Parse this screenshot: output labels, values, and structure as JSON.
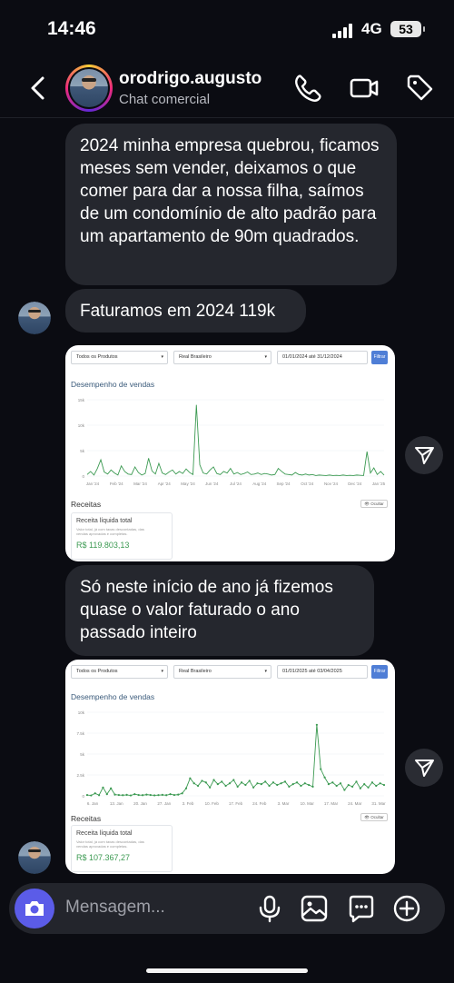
{
  "status_bar": {
    "time": "14:46",
    "network": "4G",
    "battery": "53"
  },
  "header": {
    "name": "orodrigo.augusto",
    "subtitle": "Chat comercial",
    "icons": [
      "back-icon",
      "phone-icon",
      "video-icon",
      "tag-icon"
    ]
  },
  "messages": [
    {
      "text": "2024 minha empresa quebrou, ficamos meses sem vender, deixamos o que comer para dar a nossa filha, saímos de um condomínio de alto padrão para um apartamento de 90m quadrados."
    },
    {
      "text": "Faturamos em 2024 119k"
    },
    {
      "text": "Só neste início de ano já fizemos quase o valor faturado o ano passado inteiro"
    }
  ],
  "screenshot_1": {
    "filter_products": "Todos os Produtos",
    "filter_currency": "Real Brasileiro",
    "filter_dates": "01/01/2024 até 31/12/2024",
    "filter_button": "Filtrar",
    "section_title": "Desempenho de vendas",
    "revenue_title": "Receitas",
    "hide_button": "Ocultar",
    "revenue_card_title": "Receita líquida total",
    "revenue_card_desc": "Valor total, já com taxas descontadas, das vendas aprovadas e completas.",
    "revenue_value": "R$ 119.803,13",
    "chart_data": {
      "type": "line",
      "x_ticks": [
        "Jan '24",
        "Feb '24",
        "Mar '24",
        "Apr '24",
        "May '24",
        "Jun '24",
        "Jul '24",
        "Aug '24",
        "Sep '24",
        "Oct '24",
        "Nov '24",
        "Dec '24",
        "Jan '25"
      ],
      "y_ticks": [
        "15k",
        "10k",
        "5k",
        "0"
      ],
      "ylim": [
        0,
        15000
      ],
      "values": [
        300,
        900,
        200,
        1500,
        3200,
        800,
        400,
        1200,
        600,
        200,
        2000,
        900,
        400,
        300,
        1800,
        700,
        200,
        500,
        3500,
        1000,
        400,
        2500,
        600,
        300,
        800,
        1200,
        400,
        900,
        500,
        1400,
        700,
        300,
        14000,
        2200,
        600,
        400,
        1200,
        1800,
        500,
        300,
        900,
        600,
        1500,
        400,
        700,
        300,
        500,
        800,
        300,
        400,
        600,
        300,
        500,
        400,
        200,
        300,
        1500,
        900,
        400,
        300,
        200,
        700,
        300,
        200,
        400,
        200,
        300,
        100,
        200,
        150,
        100,
        200,
        100,
        150,
        100,
        200,
        100,
        150,
        100,
        200,
        150,
        100,
        4800,
        600,
        1600,
        300,
        900,
        200
      ],
      "color": "#3c9a52"
    }
  },
  "screenshot_2": {
    "filter_products": "Todos os Produtos",
    "filter_currency": "Real Brasileiro",
    "filter_dates": "01/01/2025 até 03/04/2025",
    "filter_button": "Filtrar",
    "section_title": "Desempenho de vendas",
    "revenue_title": "Receitas",
    "hide_button": "Ocultar",
    "revenue_card_title": "Receita líquida total",
    "revenue_card_desc": "Valor total, já com taxas descontadas, das vendas aprovadas e completas.",
    "revenue_value": "R$ 107.367,27",
    "chart_data": {
      "type": "line",
      "x_ticks": [
        "6. Jan",
        "13. Jan",
        "20. Jan",
        "27. Jan",
        "3. Feb",
        "10. Feb",
        "17. Feb",
        "24. Feb",
        "3. Mar",
        "10. Mar",
        "17. Mar",
        "24. Mar",
        "31. Mar"
      ],
      "y_ticks": [
        "10k",
        "7.5k",
        "5k",
        "2.5k",
        "0"
      ],
      "ylim": [
        0,
        10000
      ],
      "values": [
        100,
        50,
        300,
        80,
        1000,
        200,
        900,
        150,
        100,
        80,
        120,
        50,
        200,
        100,
        80,
        150,
        100,
        60,
        90,
        120,
        80,
        200,
        100,
        150,
        300,
        900,
        2100,
        1500,
        1200,
        1800,
        1600,
        1000,
        1900,
        1400,
        1700,
        1200,
        1500,
        1900,
        1100,
        1600,
        1300,
        1800,
        1000,
        1500,
        1400,
        1700,
        1200,
        1600,
        1300,
        1500,
        1700,
        1100,
        1400,
        1600,
        1200,
        1500,
        1300,
        1100,
        8500,
        3200,
        2200,
        1400,
        1600,
        1200,
        1500,
        700,
        1300,
        1100,
        1700,
        900,
        1400,
        1000,
        1600,
        1200,
        1500,
        1300
      ],
      "color": "#3c9a52"
    }
  },
  "composer": {
    "placeholder": "Mensagem...",
    "icons": [
      "camera-icon",
      "microphone-icon",
      "gallery-icon",
      "sticker-icon",
      "add-icon"
    ]
  }
}
